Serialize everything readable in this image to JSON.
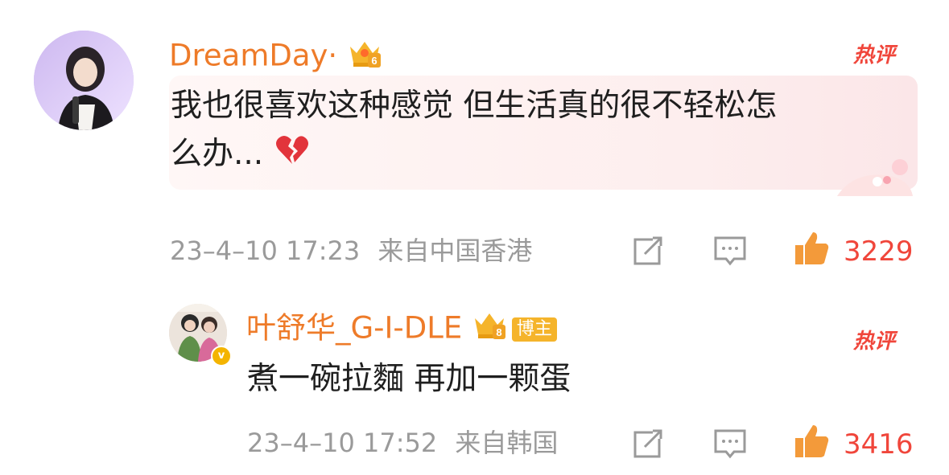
{
  "comments": [
    {
      "username": "DreamDay·",
      "user_level": "6",
      "hot_label": "热评",
      "text_line1": "我也很喜欢这种感觉 但生活真的很不轻松怎",
      "text_line2": "么办...",
      "emoji": "broken-heart",
      "timestamp": "23–4–10 17:23",
      "location": "来自中国香港",
      "likes": "3229"
    },
    {
      "username": "叶舒华_G-I-DLE",
      "user_level": "8",
      "badge": "博主",
      "hot_label": "热评",
      "text": "煮一碗拉麵 再加一颗蛋",
      "timestamp": "23–4–10 17:52",
      "location": "来自韩国",
      "likes": "3416"
    }
  ],
  "colors": {
    "username": "#ee7b29",
    "hot_label": "#f0463b",
    "like_count": "#f0463b",
    "meta": "#9a9a9a",
    "badge_bg": "#f5b42b"
  },
  "icons": [
    "repost-icon",
    "comment-icon",
    "like-icon",
    "crown-level-icon",
    "verified-icon",
    "broken-heart-icon"
  ]
}
